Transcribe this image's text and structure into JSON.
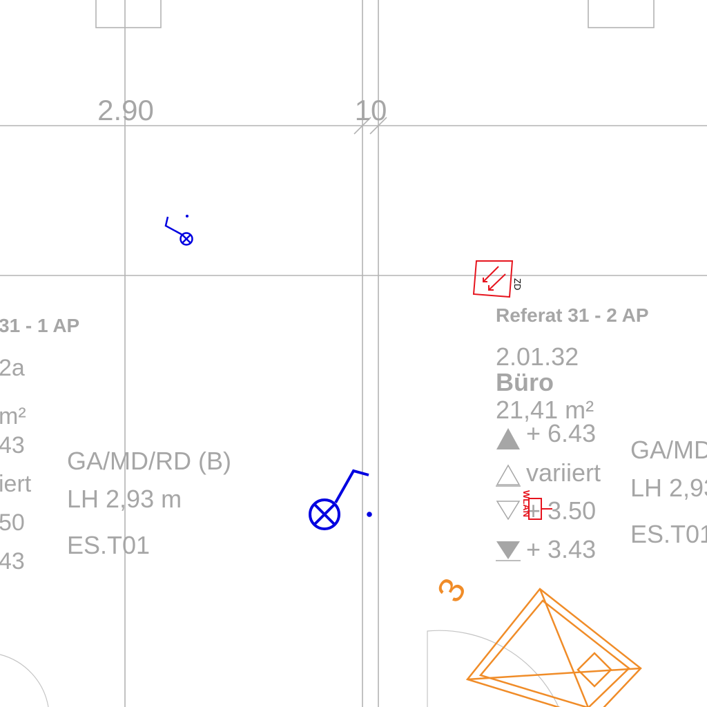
{
  "dimensions": {
    "left_top": "2.90",
    "right_top": "10"
  },
  "left_room": {
    "title": "31 -  1 AP",
    "number": "2a",
    "area": "m²",
    "lvl1": "43",
    "lvl2": "iert",
    "lvl3": "50",
    "lvl4": "43"
  },
  "left_spec": {
    "line1": "GA/MD/RD (B)",
    "line2": "LH 2,93 m",
    "line3": "ES.T01"
  },
  "right_room": {
    "title": "Referat 31 -  2 AP",
    "number": "2.01.32",
    "name": "Büro",
    "area": "21,41 m²",
    "lvl_top": "+ 6.43",
    "lvl_var": "variiert",
    "lvl_mid": "+ 3.50",
    "lvl_bot": "+ 3.43"
  },
  "right_spec": {
    "line1": "GA/MD",
    "line2": "LH 2,93",
    "line3": "ES.T01"
  },
  "symbols": {
    "zd_label": "ZD",
    "wlan_label": "WLAN",
    "stair_label": "3"
  },
  "colors": {
    "grey_text": "#a6a6a6",
    "grid": "#b3b3b3",
    "blue": "#0000e0",
    "red": "#e6141e",
    "orange": "#f08c28"
  }
}
